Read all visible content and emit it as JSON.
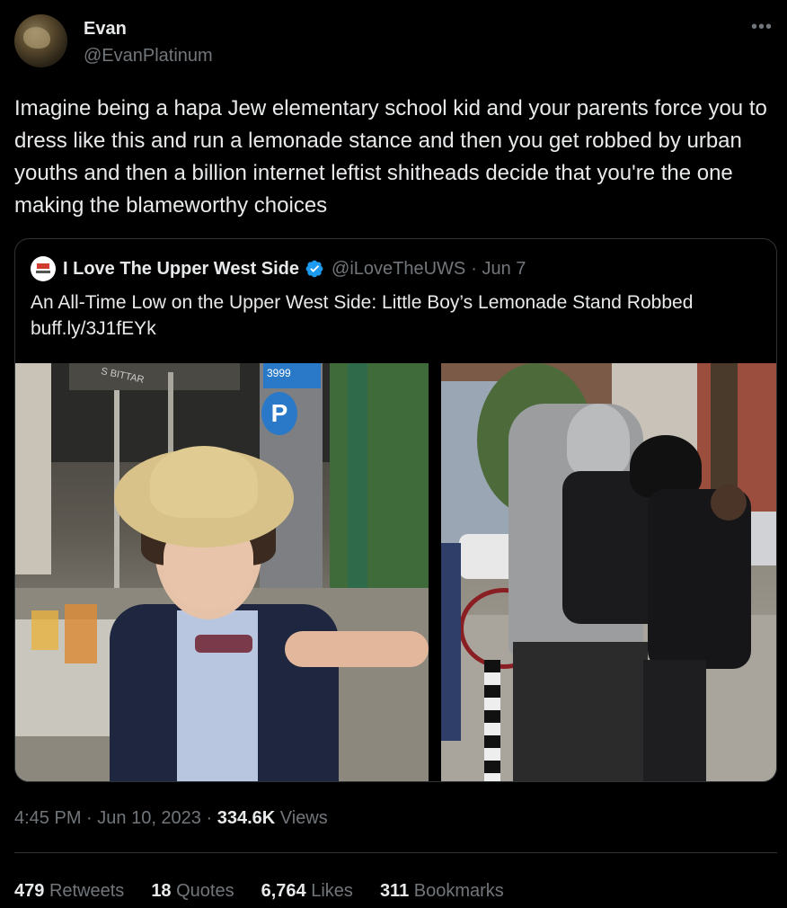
{
  "author": {
    "display_name": "Evan",
    "handle": "@EvanPlatinum",
    "avatar_icon": "avatar-image"
  },
  "more_icon": "more-options-icon",
  "tweet_text": "Imagine being a hapa Jew elementary school kid and your parents force you to dress like this and run a lemonade stance and then you get robbed by urban youths and then a billion internet leftist shitheads decide that you're the one making the blameworthy choices",
  "quoted_tweet": {
    "display_name": "I Love The Upper West Side",
    "handle": "@iLoveTheUWS",
    "date": "· Jun 7",
    "verified_icon": "verified-badge-icon",
    "text": "An All-Time Low on the Upper West Side: Little Boy’s Lemonade Stand Robbed",
    "link": "buff.ly/3J1fEYk",
    "media": [
      {
        "description_icon": "photo-boy-in-straw-hat"
      },
      {
        "description_icon": "photo-hooded-youths-with-backpacks"
      }
    ],
    "photo_signs": {
      "parking": "P",
      "meter_number": "3999",
      "store_awning": "S BITTAR"
    }
  },
  "timestamp": {
    "time": "4:45 PM",
    "date": "Jun 10, 2023",
    "views_count": "334.6K",
    "views_label": "Views"
  },
  "stats": [
    {
      "count": "479",
      "label": "Retweets"
    },
    {
      "count": "18",
      "label": "Quotes"
    },
    {
      "count": "6,764",
      "label": "Likes"
    },
    {
      "count": "311",
      "label": "Bookmarks"
    }
  ],
  "colors": {
    "background": "#000000",
    "text_primary": "#e7e9ea",
    "text_secondary": "#71767b",
    "border": "#2f3336",
    "verified_blue": "#1d9bf0"
  }
}
